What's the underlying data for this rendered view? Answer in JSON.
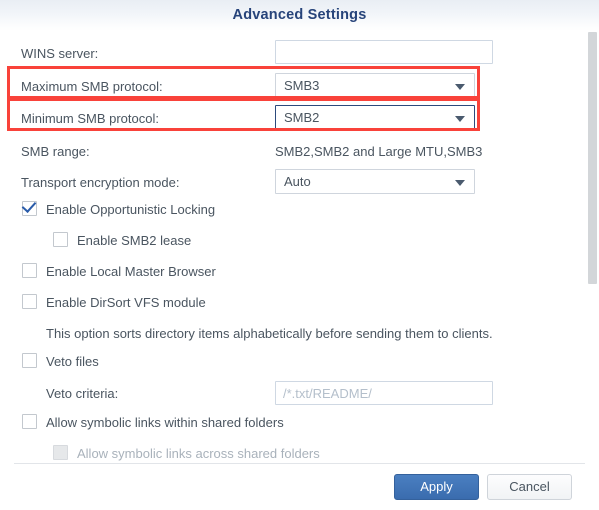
{
  "dialog": {
    "title": "Advanced Settings"
  },
  "fields": {
    "wins_server": {
      "label": "WINS server:",
      "value": "",
      "placeholder": ""
    },
    "max_smb": {
      "label": "Maximum SMB protocol:",
      "value": "SMB3"
    },
    "min_smb": {
      "label": "Minimum SMB protocol:",
      "value": "SMB2"
    },
    "smb_range": {
      "label": "SMB range:",
      "value": "SMB2,SMB2 and Large MTU,SMB3"
    },
    "transport_encryption": {
      "label": "Transport encryption mode:",
      "value": "Auto"
    },
    "veto_criteria": {
      "label": "Veto criteria:",
      "value": "",
      "placeholder": "/*.txt/README/"
    }
  },
  "checkboxes": {
    "opportunistic_locking": {
      "label": "Enable Opportunistic Locking",
      "checked": true,
      "disabled": false
    },
    "smb2_lease": {
      "label": "Enable SMB2 lease",
      "checked": false,
      "disabled": false
    },
    "local_master_browser": {
      "label": "Enable Local Master Browser",
      "checked": false,
      "disabled": false
    },
    "dirsort_vfs": {
      "label": "Enable DirSort VFS module",
      "checked": false,
      "disabled": false
    },
    "veto_files": {
      "label": "Veto files",
      "checked": false,
      "disabled": false
    },
    "symlinks_within": {
      "label": "Allow symbolic links within shared folders",
      "checked": false,
      "disabled": false
    },
    "symlinks_across": {
      "label": "Allow symbolic links across shared folders",
      "checked": false,
      "disabled": true
    }
  },
  "help": {
    "dirsort_description": "This option sorts directory items alphabetically before sending them to clients."
  },
  "footer": {
    "apply_label": "Apply",
    "cancel_label": "Cancel"
  },
  "colors": {
    "title": "#27447a",
    "highlight": "#f9423a",
    "primary_button": "#3a6cae",
    "checkmark": "#2a5caa"
  }
}
